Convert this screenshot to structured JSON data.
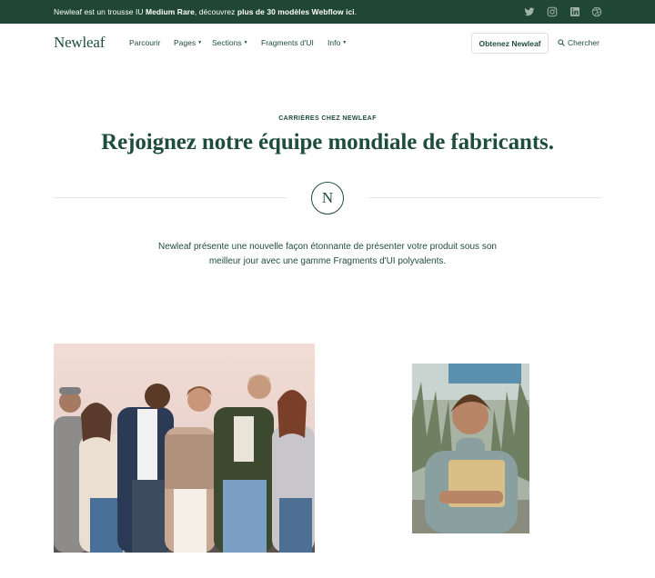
{
  "topbar": {
    "text_before": "Newleaf est un trousse IU ",
    "brand": "Medium Rare",
    "text_middle": ", découvrez ",
    "highlight": "plus de 30 modèles Webflow ici",
    "text_after": ".",
    "social": [
      "twitter-icon",
      "instagram-icon",
      "linkedin-icon",
      "dribbble-icon"
    ]
  },
  "nav": {
    "logo": "Newleaf",
    "links": [
      {
        "label": "Parcourir",
        "dropdown": false
      },
      {
        "label": "Pages",
        "dropdown": true
      },
      {
        "label": "Sections",
        "dropdown": true
      },
      {
        "label": "Fragments d'UI",
        "dropdown": false
      },
      {
        "label": "Info",
        "dropdown": true
      }
    ],
    "cta": "Obtenez Newleaf",
    "search": "Chercher"
  },
  "hero": {
    "eyebrow": "CARRIÈRES CHEZ NEWLEAF",
    "title": "Rejoignez notre équipe mondiale de fabricants.",
    "emblem": "N",
    "description": "Newleaf présente une nouvelle façon étonnante de présenter votre produit sous son meilleur jour avec une gamme Fragments d'UI polyvalents."
  },
  "colors": {
    "brand_dark": "#1f4636",
    "text_green": "#1f4d3d",
    "divider": "#e4e7e5"
  }
}
